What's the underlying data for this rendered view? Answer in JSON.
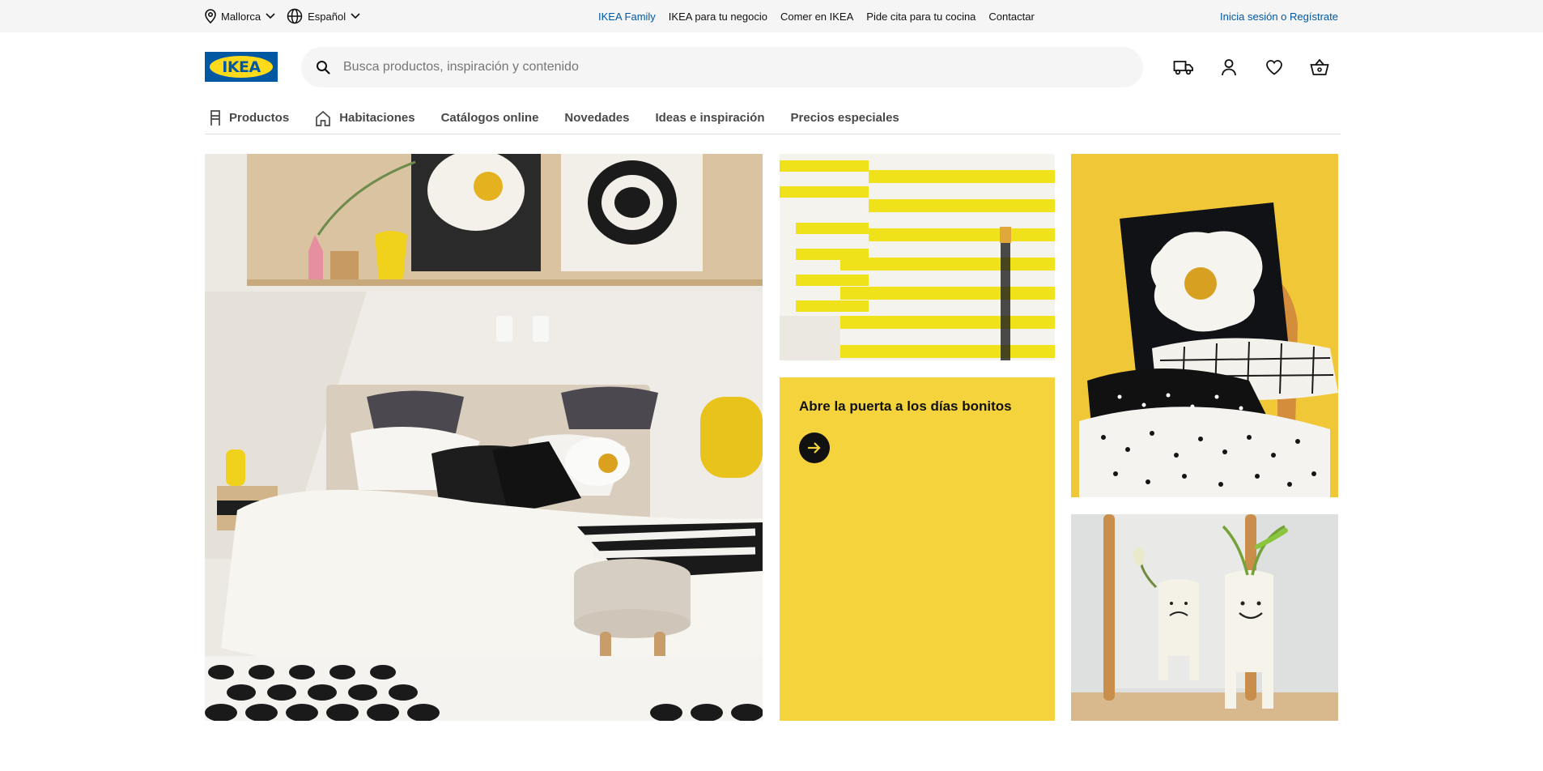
{
  "topbar": {
    "location": "Mallorca",
    "language": "Español",
    "links": [
      "IKEA Family",
      "IKEA para tu negocio",
      "Comer en IKEA",
      "Pide cita para tu cocina",
      "Contactar"
    ],
    "login": "Inicia sesión o Regístrate"
  },
  "header": {
    "logo_text": "IKEA",
    "search_placeholder": "Busca productos, inspiración y contenido",
    "icons": [
      "delivery-truck-icon",
      "user-icon",
      "heart-icon",
      "basket-icon"
    ]
  },
  "nav": {
    "items": [
      "Productos",
      "Habitaciones",
      "Catálogos online",
      "Novedades",
      "Ideas e inspiración",
      "Precios especiales"
    ]
  },
  "promo": {
    "title": "Abre la puerta a los días bonitos"
  },
  "colors": {
    "brand_blue": "#0058a3",
    "brand_yellow": "#ffda1a",
    "promo_yellow": "#f5d33c"
  }
}
